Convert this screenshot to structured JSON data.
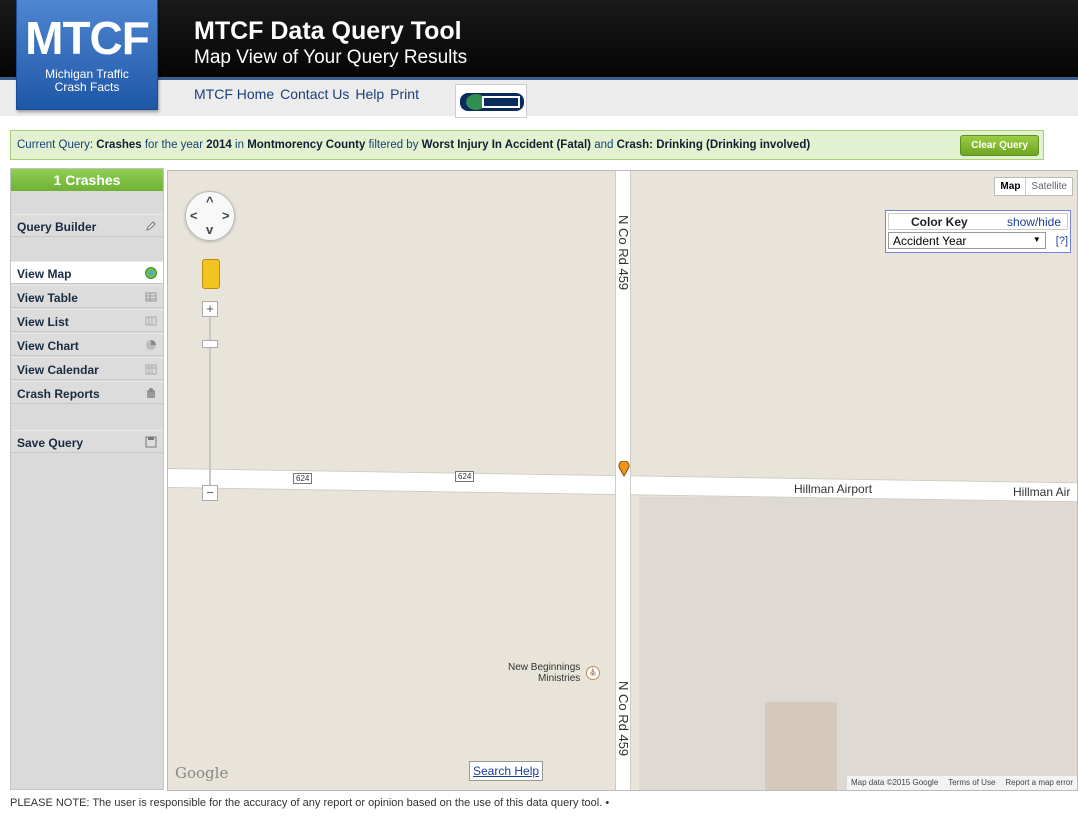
{
  "header": {
    "logo_big": "MTCF",
    "logo_small_line1": "Michigan Traffic",
    "logo_small_line2": "Crash Facts",
    "title": "MTCF Data Query Tool",
    "subtitle": "Map View of Your Query Results",
    "nav": [
      "MTCF Home",
      "Contact Us",
      "Help",
      "Print"
    ],
    "partner_logo_icon": "ohsp-logo"
  },
  "query_bar": {
    "prefix": "Current Query:",
    "q1": "Crashes",
    "t1": "for the year",
    "q2": "2014",
    "t2": "in",
    "q3": "Montmorency County",
    "t3": "filtered by",
    "q4": "Worst Injury In Accident (Fatal)",
    "t4": "and",
    "q5": "Crash: Drinking (Drinking involved)",
    "clear_button": "Clear Query"
  },
  "sidebar": {
    "count_label": "1 Crashes",
    "items": [
      {
        "label": "Query Builder",
        "icon": "pencil-icon",
        "active": false
      },
      {
        "label": "View Map",
        "icon": "globe-icon",
        "active": true
      },
      {
        "label": "View Table",
        "icon": "table-icon",
        "active": false
      },
      {
        "label": "View List",
        "icon": "list-icon",
        "active": false
      },
      {
        "label": "View Chart",
        "icon": "pie-chart-icon",
        "active": false
      },
      {
        "label": "View Calendar",
        "icon": "calendar-icon",
        "active": false
      },
      {
        "label": "Crash Reports",
        "icon": "report-icon",
        "active": false
      },
      {
        "label": "Save Query",
        "icon": "floppy-disk-icon",
        "active": false
      }
    ]
  },
  "map": {
    "type_buttons": [
      "Map",
      "Satellite"
    ],
    "color_key": {
      "title": "Color Key",
      "toggle": "show/hide",
      "selected": "Accident Year",
      "help": "[?]"
    },
    "road_vertical_top": "N Co Rd 459",
    "road_vertical_bottom": "N Co Rd 459",
    "road_horizontal_left": "624",
    "road_horizontal_right": "624",
    "airport_label_1": "Hillman Airport",
    "airport_label_2": "Hillman Air",
    "poi_line1": "New Beginnings",
    "poi_line2": "Ministries",
    "google": "Google",
    "search_help": "Search Help",
    "footer": [
      "Map data ©2015 Google",
      "Terms of Use",
      "Report a map error"
    ]
  },
  "note": "PLEASE NOTE: The user is responsible for the accuracy of any report or opinion based on the use of this data query tool. •",
  "colors": {
    "accent_green": "#7fbf3f",
    "header_dark": "#0d0d0d",
    "logo_blue": "#2f6cc0"
  }
}
